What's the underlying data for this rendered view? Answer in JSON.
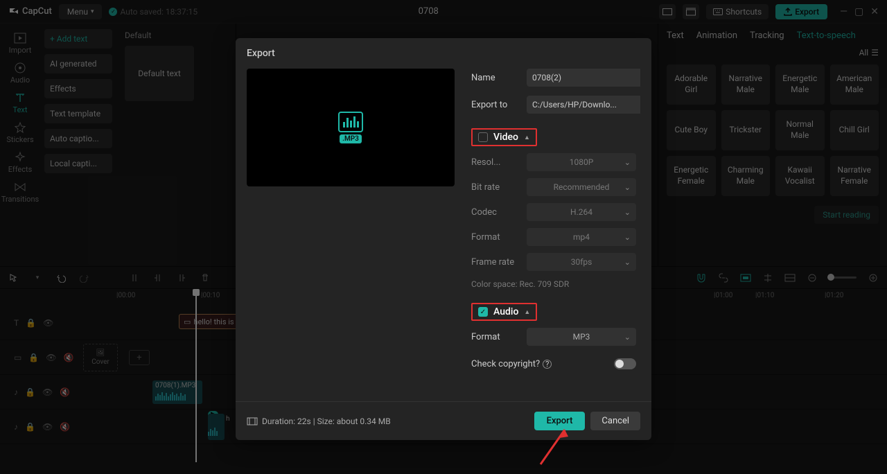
{
  "app": {
    "name": "CapCut",
    "menu": "Menu",
    "autosave": "Auto saved: 18:37:15",
    "project": "0708",
    "shortcuts": "Shortcuts",
    "export": "Export"
  },
  "nav": {
    "import": "Import",
    "audio": "Audio",
    "text": "Text",
    "stickers": "Stickers",
    "effects": "Effects",
    "transitions": "Transitions"
  },
  "sidebar": {
    "add_text": "+ Add text",
    "ai_generated": "AI generated",
    "effects": "Effects",
    "text_template": "Text template",
    "auto_captions": "Auto captio...",
    "local_captions": "Local capti..."
  },
  "content": {
    "default_label": "Default",
    "default_text": "Default text"
  },
  "right": {
    "tabs": {
      "text": "Text",
      "animation": "Animation",
      "tracking": "Tracking",
      "tts": "Text-to-speech"
    },
    "all": "All",
    "voices": [
      "Adorable Girl",
      "Narrative Male",
      "Energetic Male",
      "American Male",
      "Cute Boy",
      "Trickster",
      "Normal Male",
      "Chill Girl",
      "Energetic Female",
      "Charming Male",
      "Kawaii Vocalist",
      "Narrative Female"
    ],
    "start_reading": "Start reading"
  },
  "timeline": {
    "marks": [
      "|00:00",
      "|00:10",
      "|01:00",
      "|01:10",
      "|01:20"
    ],
    "text_clip": "hello! this is ...",
    "cover": "Cover",
    "audio_clip": "0708(1).MP3",
    "audio_clip2_prefix": "h"
  },
  "modal": {
    "title": "Export",
    "name_label": "Name",
    "name_value": "0708(2)",
    "exportto_label": "Export to",
    "exportto_value": "C:/Users/HP/Downlo...",
    "video": {
      "title": "Video",
      "resolution_label": "Resol...",
      "resolution_value": "1080P",
      "bitrate_label": "Bit rate",
      "bitrate_value": "Recommended",
      "codec_label": "Codec",
      "codec_value": "H.264",
      "format_label": "Format",
      "format_value": "mp4",
      "framerate_label": "Frame rate",
      "framerate_value": "30fps",
      "color_note": "Color space: Rec. 709 SDR"
    },
    "audio": {
      "title": "Audio",
      "format_label": "Format",
      "format_value": "MP3"
    },
    "mp3_badge": ".MP3",
    "copyright_label": "Check copyright?",
    "footer_info": "Duration: 22s | Size: about 0.34 MB",
    "export_btn": "Export",
    "cancel_btn": "Cancel"
  }
}
